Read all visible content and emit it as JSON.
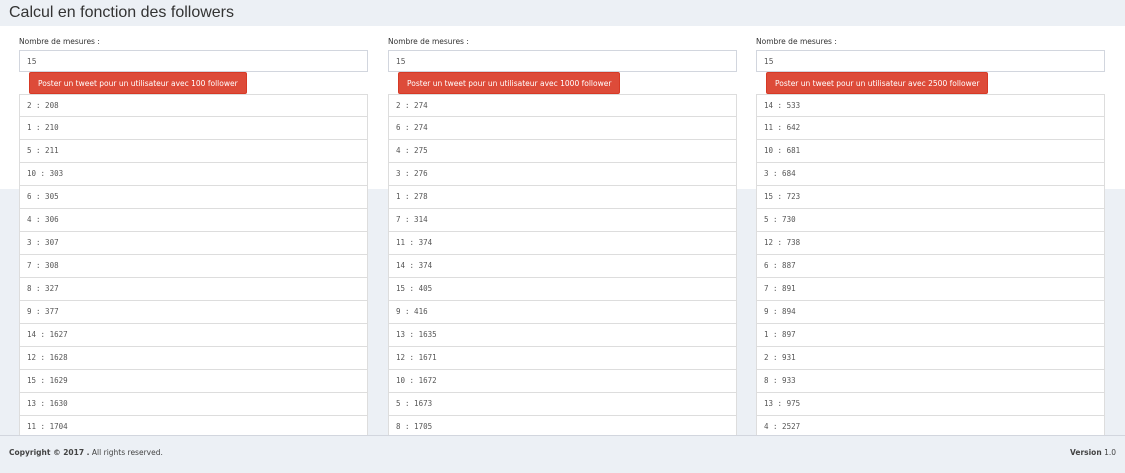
{
  "header": {
    "title": "Calcul en fonction des followers"
  },
  "columns": [
    {
      "label": "Nombre de mesures :",
      "input_value": "15",
      "button_label": "Poster un tweet pour un utilisateur avec 100 follower",
      "results": [
        "2 : 208",
        "1 : 210",
        "5 : 211",
        "10 : 303",
        "6 : 305",
        "4 : 306",
        "3 : 307",
        "7 : 308",
        "8 : 327",
        "9 : 377",
        "14 : 1627",
        "12 : 1628",
        "15 : 1629",
        "13 : 1630",
        "11 : 1704"
      ]
    },
    {
      "label": "Nombre de mesures :",
      "input_value": "15",
      "button_label": "Poster un tweet pour un utilisateur avec 1000 follower",
      "results": [
        "2 : 274",
        "6 : 274",
        "4 : 275",
        "3 : 276",
        "1 : 278",
        "7 : 314",
        "11 : 374",
        "14 : 374",
        "15 : 405",
        "9 : 416",
        "13 : 1635",
        "12 : 1671",
        "10 : 1672",
        "5 : 1673",
        "8 : 1705"
      ]
    },
    {
      "label": "Nombre de mesures :",
      "input_value": "15",
      "button_label": "Poster un tweet pour un utilisateur avec 2500 follower",
      "results": [
        "14 : 533",
        "11 : 642",
        "10 : 681",
        "3 : 684",
        "15 : 723",
        "5 : 730",
        "12 : 738",
        "6 : 887",
        "7 : 891",
        "9 : 894",
        "1 : 897",
        "2 : 931",
        "8 : 933",
        "13 : 975",
        "4 : 2527"
      ]
    }
  ],
  "footer": {
    "copyright_bold": "Copyright © 2017 .",
    "copyright_rest": " All rights reserved.",
    "version_label": "Version",
    "version_number": " 1.0"
  },
  "colors": {
    "button_red": "#dd4b39",
    "background": "#ecf0f5",
    "panel": "#ffffff"
  }
}
